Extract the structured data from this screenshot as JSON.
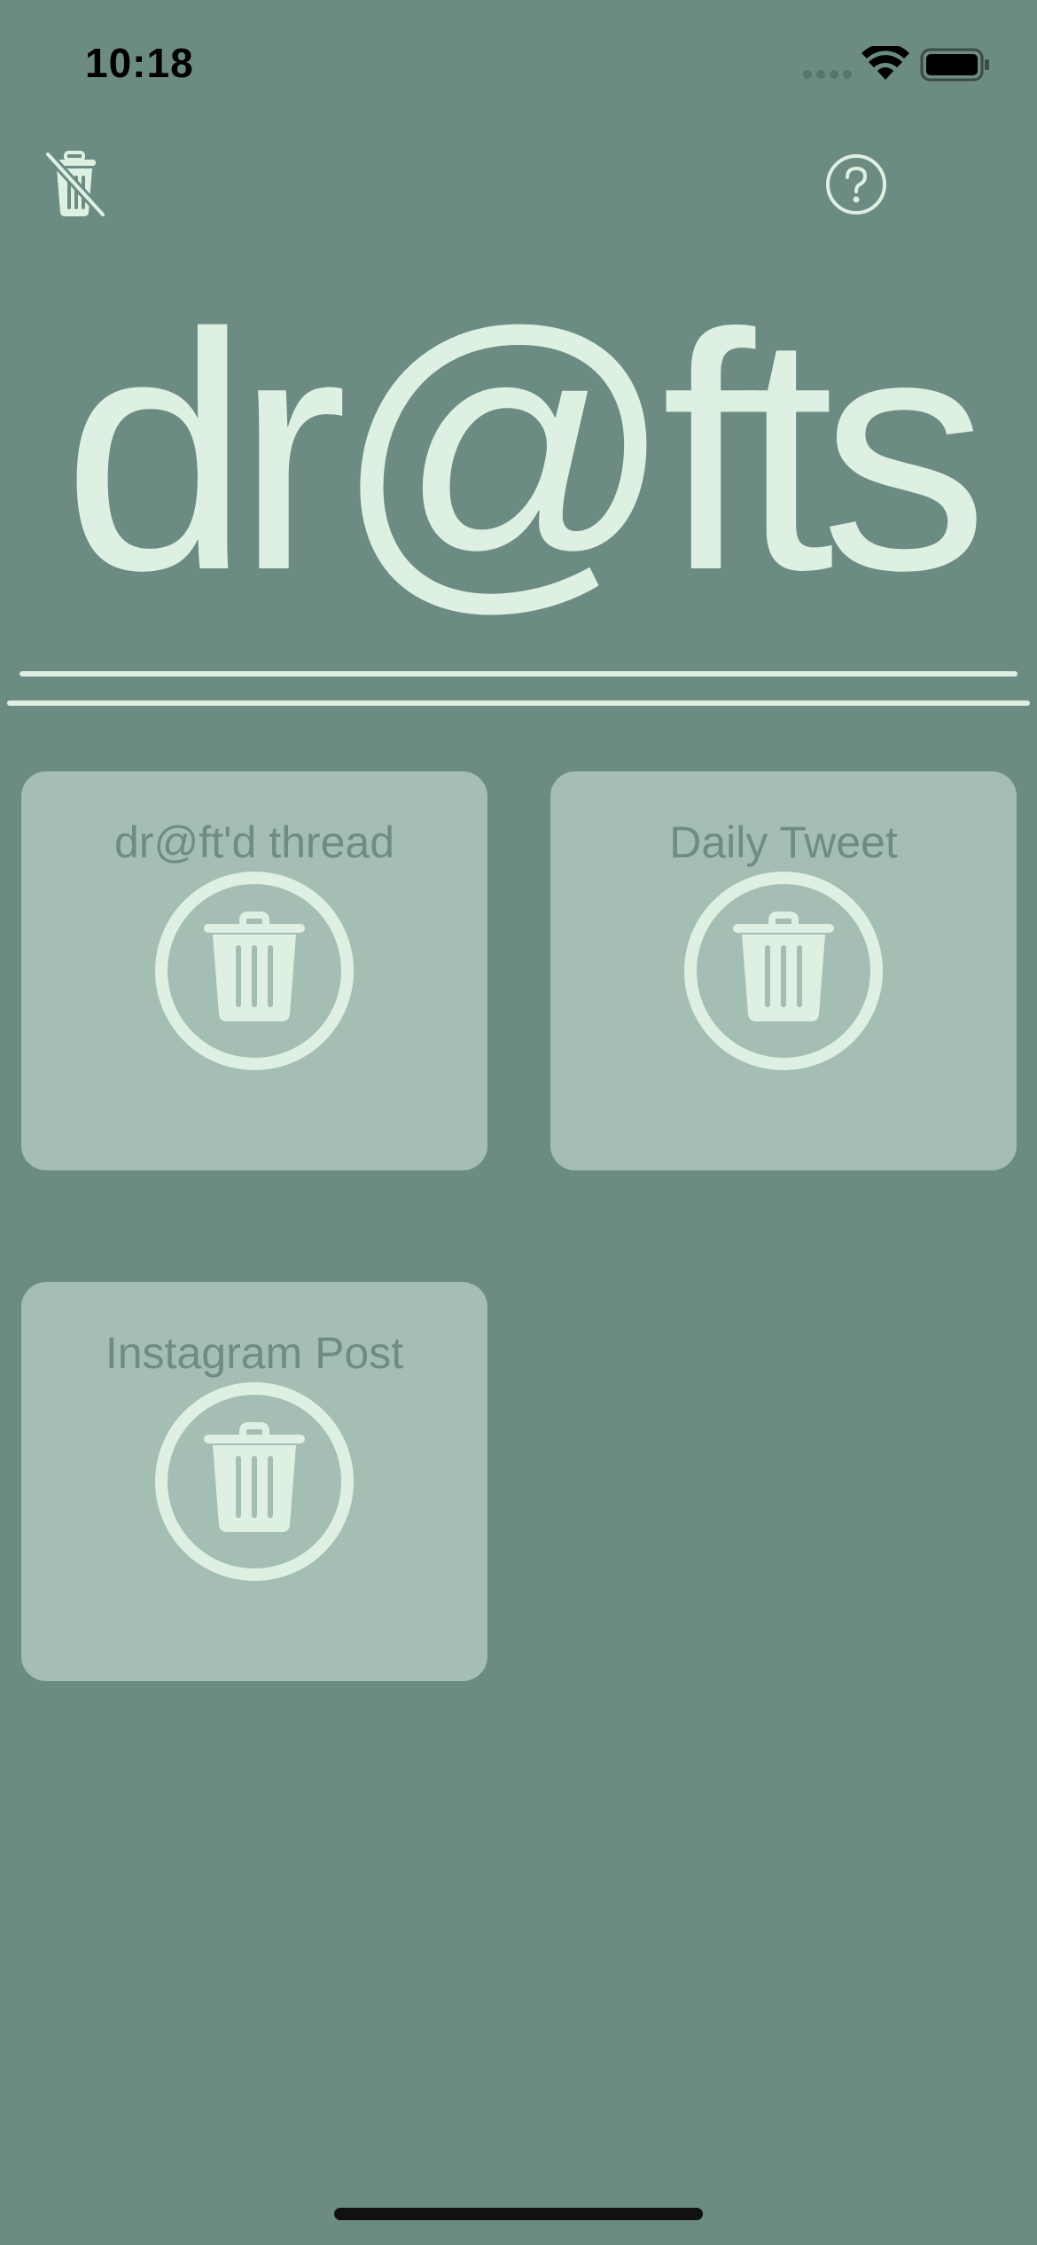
{
  "status_bar": {
    "time": "10:18",
    "signal_icon": "cellular-signal-icon",
    "wifi_icon": "wifi-icon",
    "battery_icon": "battery-full-icon"
  },
  "toolbar": {
    "left_icon": "trash-slash-icon",
    "right_icon": "question-circle-icon"
  },
  "app": {
    "title": "dr@fts"
  },
  "colors": {
    "background": "#6b8b83",
    "accent": "#ddf0e2",
    "card": "#a4beb3",
    "card_text": "#6f8c84"
  },
  "drafts": [
    {
      "title": "dr@ft'd thread",
      "action_icon": "trash-circle-icon"
    },
    {
      "title": "Daily Tweet",
      "action_icon": "trash-circle-icon"
    },
    {
      "title": "Instagram Post",
      "action_icon": "trash-circle-icon"
    }
  ]
}
